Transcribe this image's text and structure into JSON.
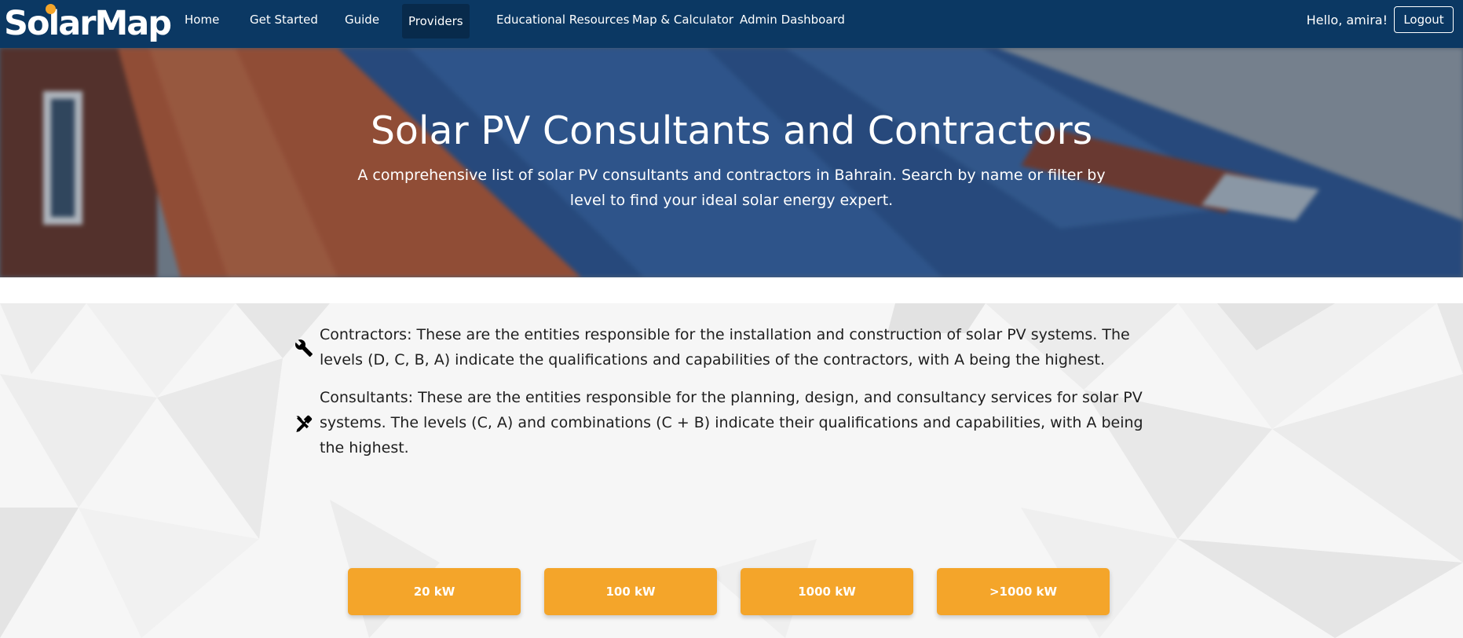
{
  "brand": {
    "name": "SolarMap",
    "accent": "#f4a52a",
    "navbar_bg": "#0b3863"
  },
  "nav": {
    "items": [
      {
        "label": "Home"
      },
      {
        "label": "Get Started"
      },
      {
        "label": "Guide"
      },
      {
        "label": "Providers",
        "active": true
      },
      {
        "label": "Educational Resources"
      },
      {
        "label": "Map & Calculator"
      },
      {
        "label": "Admin Dashboard"
      }
    ],
    "greeting": "Hello, amira!",
    "logout_label": "Logout"
  },
  "hero": {
    "title": "Solar PV Consultants and Contractors",
    "subtitle": "A comprehensive list of solar PV consultants and contractors in Bahrain. Search by name or filter by level to find your ideal solar energy expert."
  },
  "info": {
    "contractors": {
      "icon": "wrench-icon",
      "text": "Contractors: These are the entities responsible for the installation and construction of solar PV systems. The levels (D, C, B, A) indicate the qualifications and capabilities of the contractors, with A being the highest."
    },
    "consultants": {
      "icon": "tools-icon",
      "text": "Consultants: These are the entities responsible for the planning, design, and consultancy services for solar PV systems. The levels (C, A) and combinations (C + B) indicate their qualifications and capabilities, with A being the highest."
    }
  },
  "capacity_filters": [
    {
      "label": "20 kW"
    },
    {
      "label": "100 kW"
    },
    {
      "label": "1000 kW"
    },
    {
      "label": ">1000 kW"
    }
  ]
}
